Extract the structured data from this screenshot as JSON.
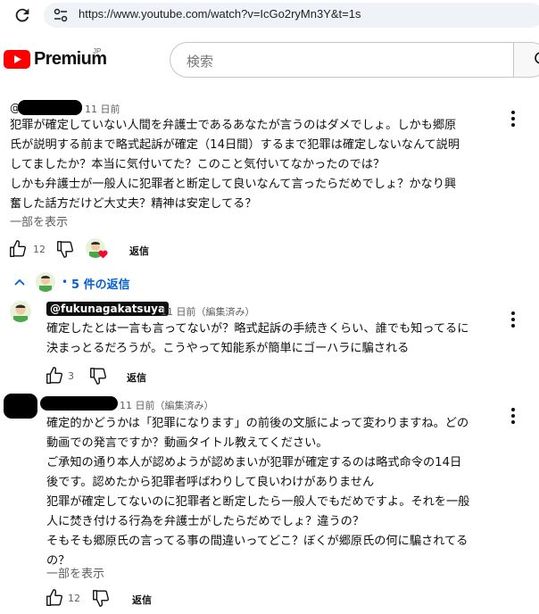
{
  "browser": {
    "url": "https://www.youtube.com/watch?v=IcGo2ryMn3Y&t=1s"
  },
  "header": {
    "brand": "Premium",
    "region": "JP",
    "search_placeholder": "検索"
  },
  "comment1": {
    "timestamp": "11 日前",
    "lines": [
      "犯罪が確定していない人間を弁護士であるあなたが言うのはダメでしょ。しかも郷原",
      "氏が説明する前まで略式起訴が確定（14日間）するまで犯罪は確定しないなんて説明",
      "してましたか？本当に気付いてた？このこと気付いてなかったのでは？",
      "しかも弁護士が一般人に犯罪者と断定して良いなんて言ったらだめでしょ？かなり興",
      "奮した話方だけど大丈夫？精神は安定してる？"
    ],
    "show_more": "一部を表示",
    "likes": "12",
    "reply_label": "返信",
    "replies_toggle": "5 件の返信"
  },
  "reply1": {
    "handle": "@fukunagakatsuya",
    "timestamp": "11 日前（編集済み）",
    "lines": [
      "確定したとは一言も言ってないが？略式起訴の手続きくらい、誰でも知ってるに",
      "決まっとるだろうが。こうやって知能系が簡単にゴーハラに騙される"
    ],
    "likes": "3",
    "reply_label": "返信"
  },
  "reply2": {
    "timestamp": "11 日前（編集済み）",
    "lines": [
      "確定的かどうかは「犯罪になります」の前後の文脈によって変わりますね。どの",
      "動画での発言ですか？動画タイトル教えてください。",
      "ご承知の通り本人が認めようが認めまいが犯罪が確定するのは略式命令の14日",
      "後です。認めたから犯罪者呼ばわりして良いわけがありません",
      "犯罪が確定してないのに犯罪者と断定したら一般人でもだめですよ。それを一般",
      "人に焚き付ける行為を弁護士がしたらだめでしょ？違うの？",
      "そもそも郷原氏の言ってる事の間違いってどこ？ぼくが郷原氏の何に騙されてる",
      "の？"
    ],
    "show_more": "一部を表示",
    "likes": "12",
    "reply_label": "返信"
  },
  "colors": {
    "brand_red": "#ff0000",
    "link_blue": "#065fd4",
    "heart_red": "#ff0033"
  }
}
